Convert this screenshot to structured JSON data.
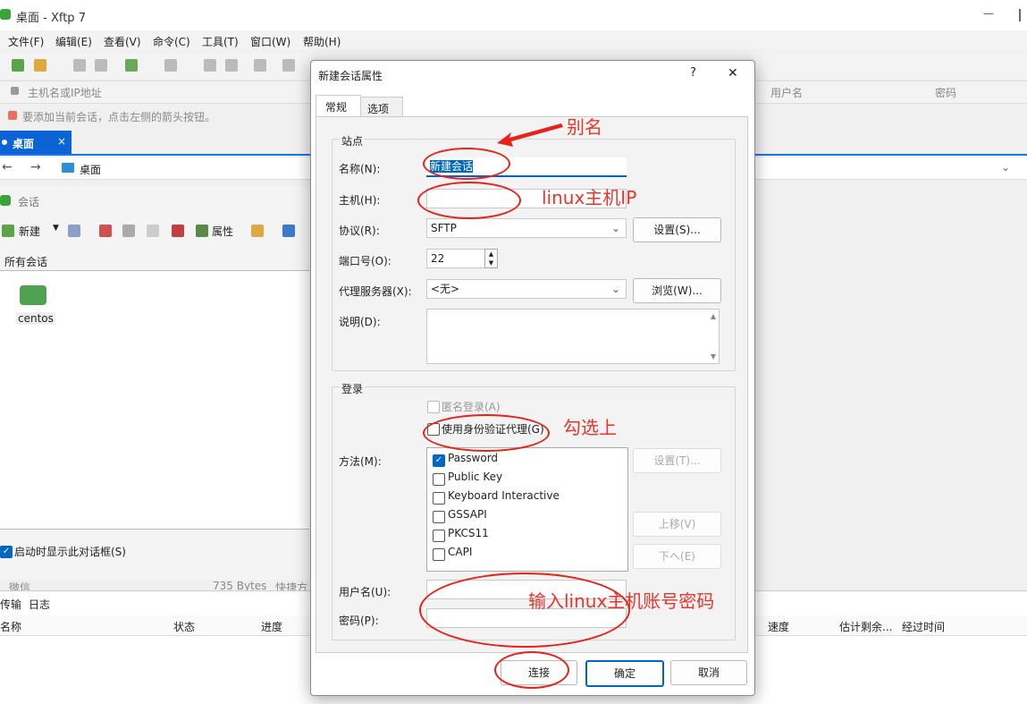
{
  "window": {
    "title": "桌面 - Xftp 7",
    "minimize_glyph": "—",
    "close_glyph": "✕"
  },
  "menu": [
    "文件(F)",
    "编辑(E)",
    "查看(V)",
    "命令(C)",
    "工具(T)",
    "窗口(W)",
    "帮助(H)"
  ],
  "addressbar": {
    "host_placeholder": "主机名或IP地址",
    "username_placeholder": "用户名",
    "password_placeholder": "密码"
  },
  "hint": "要添加当前会话，点击左侧的箭头按钮。",
  "tab": {
    "label": "桌面",
    "close": "×"
  },
  "path": {
    "label": "桌面"
  },
  "sessions": {
    "title": "会话",
    "new_label": "新建",
    "props_label": "属性",
    "list_header": "所有会话",
    "items": [
      {
        "name": "centos"
      }
    ],
    "startup_checkbox": "启动时显示此对话框(S)"
  },
  "bottom": {
    "tabs": [
      "传输",
      "日志"
    ],
    "columns": [
      "名称",
      "状态",
      "进度",
      "速度",
      "估计剩余...",
      "经过时间"
    ],
    "peek": [
      "微信",
      "735 Bytes",
      "快捷方"
    ]
  },
  "dialog": {
    "title": "新建会话属性",
    "help": "?",
    "close": "✕",
    "tabs": [
      "常规",
      "选项"
    ],
    "site": {
      "legend": "站点",
      "name_label": "名称(N):",
      "name_value": "新建会话",
      "host_label": "主机(H):",
      "host_value": "",
      "protocol_label": "协议(R):",
      "protocol_value": "SFTP",
      "settings_button": "设置(S)...",
      "port_label": "端口号(O):",
      "port_value": "22",
      "proxy_label": "代理服务器(X):",
      "proxy_value": "<无>",
      "browse_button": "浏览(W)...",
      "desc_label": "说明(D):"
    },
    "login": {
      "legend": "登录",
      "anonymous": "匿名登录(A)",
      "use_agent": "使用身份验证代理(G)",
      "method_label": "方法(M):",
      "methods": [
        {
          "name": "Password",
          "checked": true
        },
        {
          "name": "Public Key",
          "checked": false
        },
        {
          "name": "Keyboard Interactive",
          "checked": false
        },
        {
          "name": "GSSAPI",
          "checked": false
        },
        {
          "name": "PKCS11",
          "checked": false
        },
        {
          "name": "CAPI",
          "checked": false
        }
      ],
      "method_settings": "设置(T)...",
      "move_up": "上移(V)",
      "move_down": "下へ(E)",
      "username_label": "用户名(U):",
      "password_label": "密码(P):"
    },
    "buttons": {
      "connect": "连接",
      "ok": "确定",
      "cancel": "取消"
    }
  },
  "annotations": {
    "alias": "别名",
    "host_ip": "linux主机IP",
    "check_it": "勾选上",
    "enter_credentials": "输入linux主机账号密码",
    "color": "#e5231b"
  }
}
